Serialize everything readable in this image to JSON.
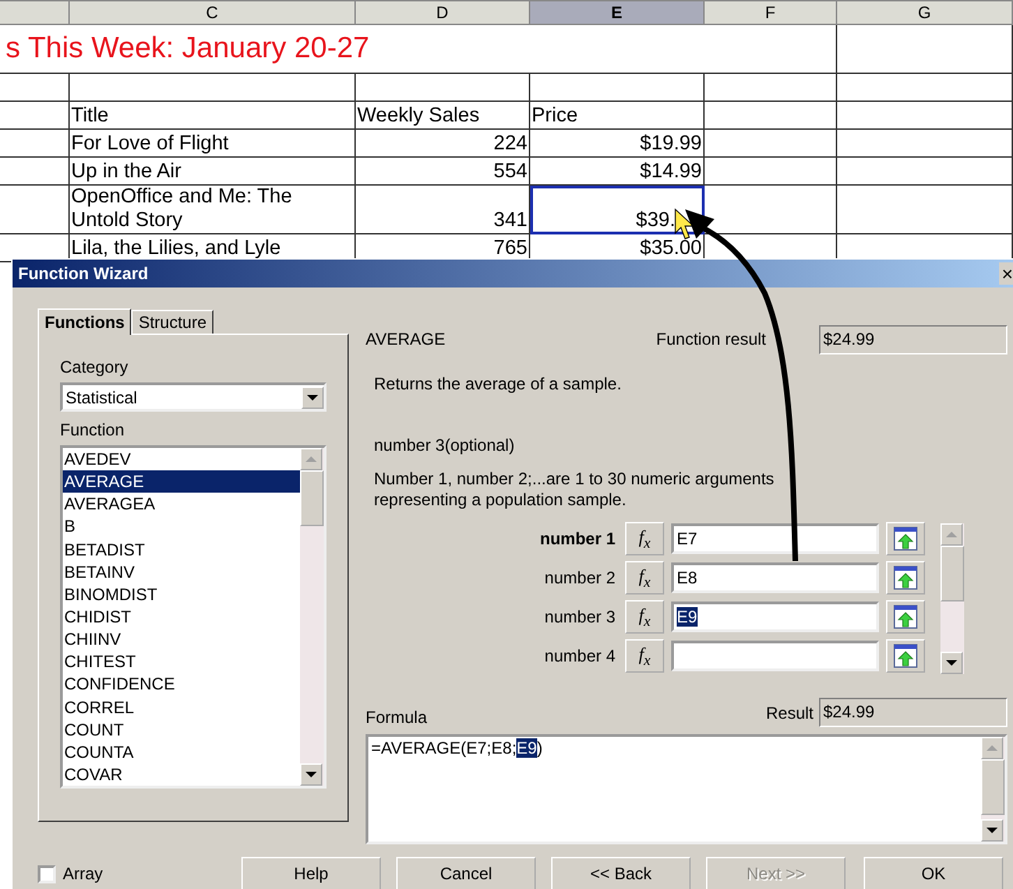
{
  "sheet": {
    "columns": [
      {
        "label": "C",
        "selected": false
      },
      {
        "label": "D",
        "selected": false
      },
      {
        "label": "E",
        "selected": true
      },
      {
        "label": "F",
        "selected": false
      },
      {
        "label": "G",
        "selected": false
      }
    ],
    "title": "s This Week: January 20-27",
    "header": {
      "title": "Title",
      "weekly_sales": "Weekly Sales",
      "price": "Price"
    },
    "rows": [
      {
        "title": "For Love of Flight",
        "weekly_sales": "224",
        "price": "$19.99",
        "price_selected": false
      },
      {
        "title": "Up in the Air",
        "weekly_sales": "554",
        "price": "$14.99",
        "price_selected": false
      },
      {
        "title": "OpenOffice and Me: The Untold Story",
        "weekly_sales": "341",
        "price": "$39.",
        "price_selected": true
      },
      {
        "title": "Lila, the Lilies, and Lyle",
        "weekly_sales": "765",
        "price": "$35.00",
        "price_selected": false
      }
    ]
  },
  "dialog": {
    "title": "Function Wizard",
    "close": "×",
    "tabs": [
      {
        "label": "Functions",
        "selected": true
      },
      {
        "label": "Structure",
        "selected": false
      }
    ],
    "category": {
      "label": "Category",
      "value": "Statistical"
    },
    "function_list": {
      "label": "Function",
      "items": [
        {
          "label": "AVEDEV",
          "selected": false
        },
        {
          "label": "AVERAGE",
          "selected": true
        },
        {
          "label": "AVERAGEA",
          "selected": false
        },
        {
          "label": "B",
          "selected": false
        },
        {
          "label": "BETADIST",
          "selected": false
        },
        {
          "label": "BETAINV",
          "selected": false
        },
        {
          "label": "BINOMDIST",
          "selected": false
        },
        {
          "label": "CHIDIST",
          "selected": false
        },
        {
          "label": "CHIINV",
          "selected": false
        },
        {
          "label": "CHITEST",
          "selected": false
        },
        {
          "label": "CONFIDENCE",
          "selected": false
        },
        {
          "label": "CORREL",
          "selected": false
        },
        {
          "label": "COUNT",
          "selected": false
        },
        {
          "label": "COUNTA",
          "selected": false
        },
        {
          "label": "COVAR",
          "selected": false
        }
      ]
    },
    "function_name": "AVERAGE",
    "function_result": {
      "label": "Function result",
      "value": "$24.99"
    },
    "description": "Returns the average of a sample.",
    "argument_name": "number 3(optional)",
    "argument_description": "Number 1, number 2;...are 1 to 30 numeric arguments representing a population sample.",
    "arguments": [
      {
        "label": "number 1",
        "required": true,
        "fx": "f$_{x}$",
        "value": "E7",
        "value_selected": false
      },
      {
        "label": "number 2",
        "required": false,
        "fx": "f$_{x}$",
        "value": "E8",
        "value_selected": false
      },
      {
        "label": "number 3",
        "required": false,
        "fx": "f$_{x}$",
        "value": "E9",
        "value_selected": true
      },
      {
        "label": "number 4",
        "required": false,
        "fx": "f$_{x}$"
      }
    ],
    "formula": {
      "label": "Formula",
      "parts": [
        {
          "text": "=AVERAGE(E7;E8;",
          "selected": false
        },
        {
          "text": "E9",
          "selected": true
        },
        {
          "text": ")",
          "selected": false
        }
      ]
    },
    "result": {
      "label": "Result",
      "value": "$24.99"
    },
    "array": {
      "label": "Array",
      "checked": false
    },
    "buttons": [
      {
        "label": "Help",
        "disabled": false
      },
      {
        "label": "Cancel",
        "disabled": false
      },
      {
        "label": "<< Back",
        "disabled": false
      },
      {
        "label": "Next >>",
        "disabled": true
      },
      {
        "label": "OK",
        "disabled": false
      }
    ]
  }
}
